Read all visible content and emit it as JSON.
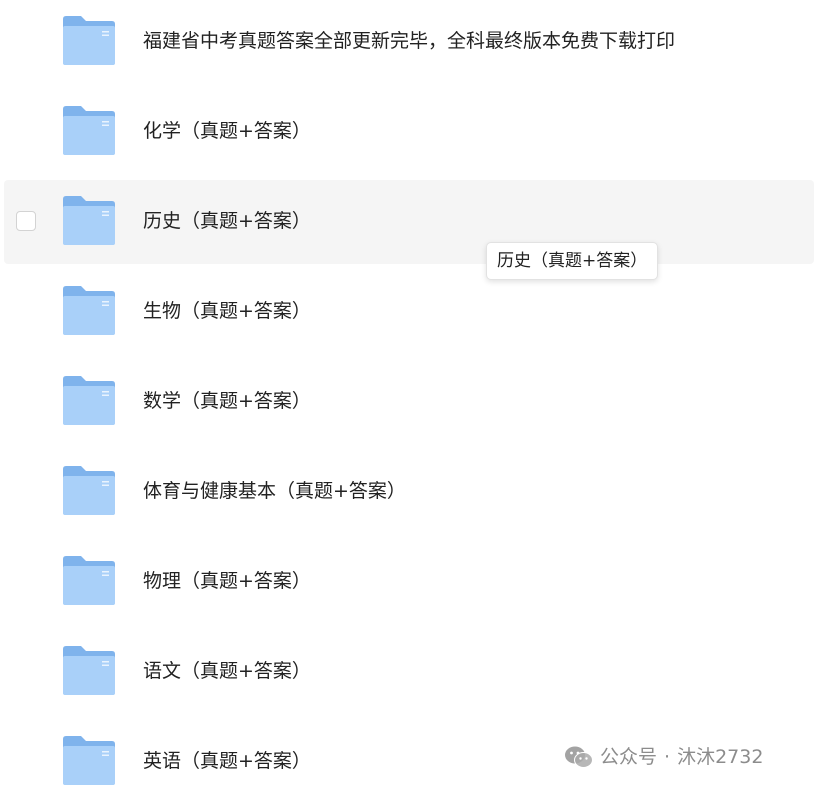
{
  "files": [
    {
      "name": "福建省中考真题答案全部更新完毕，全科最终版本免费下载打印",
      "hovered": false
    },
    {
      "name": "化学（真题+答案）",
      "hovered": false
    },
    {
      "name": "历史（真题+答案）",
      "hovered": true
    },
    {
      "name": "生物（真题+答案）",
      "hovered": false
    },
    {
      "name": "数学（真题+答案）",
      "hovered": false
    },
    {
      "name": "体育与健康基本（真题+答案）",
      "hovered": false
    },
    {
      "name": "物理（真题+答案）",
      "hovered": false
    },
    {
      "name": "语文（真题+答案）",
      "hovered": false
    },
    {
      "name": "英语（真题+答案）",
      "hovered": false
    }
  ],
  "tooltip": {
    "text": "历史（真题+答案）"
  },
  "watermark": {
    "prefix": "公众号",
    "separator": "·",
    "account": "沐沐2732",
    "icon": "wechat-icon"
  },
  "colors": {
    "folder_back": "#7fb3ec",
    "folder_front": "#a9d0f9",
    "hover_row": "#f5f5f5"
  }
}
